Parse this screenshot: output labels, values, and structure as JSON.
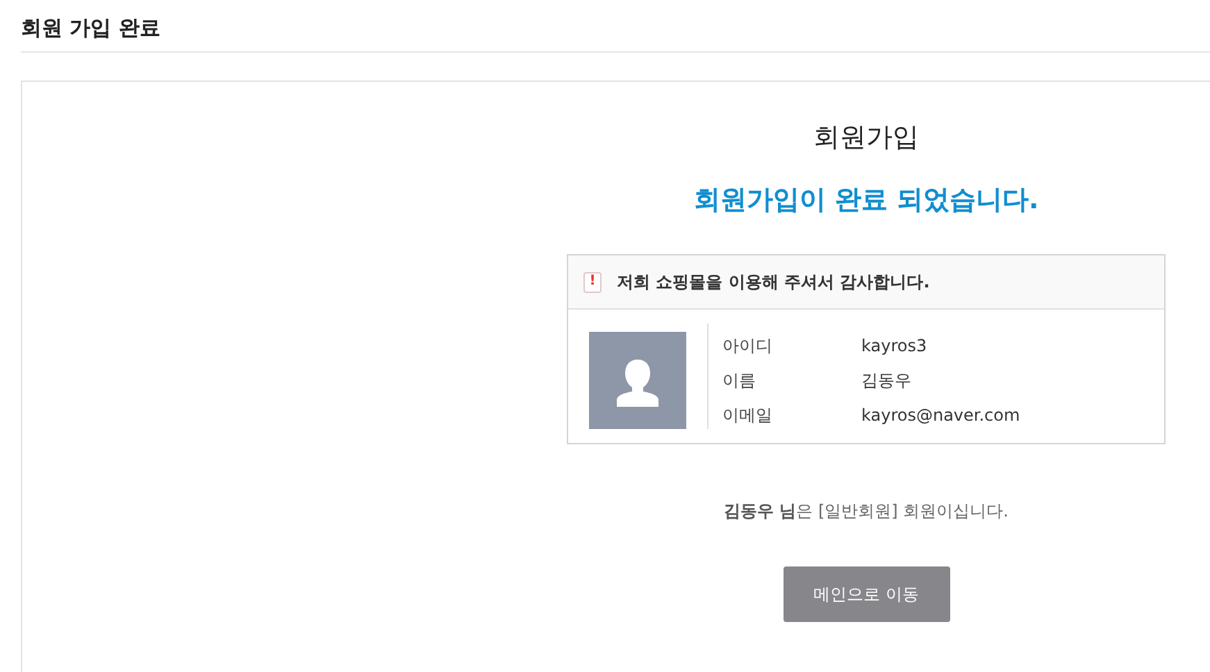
{
  "page_title": "회원 가입 완료",
  "heading": "회원가입",
  "complete_message": "회원가입이 완료 되었습니다.",
  "notice": {
    "icon": "!",
    "text": "저희 쇼핑몰을 이용해 주셔서 감사합니다."
  },
  "member_info": [
    {
      "label": "아이디",
      "value": "kayros3"
    },
    {
      "label": "이름",
      "value": "김동우"
    },
    {
      "label": "이메일",
      "value": "kayros@naver.com"
    }
  ],
  "grade_message": "**김동우 님**은 [일반회원] 회원이십니다.",
  "main_button": "메인으로 이동"
}
